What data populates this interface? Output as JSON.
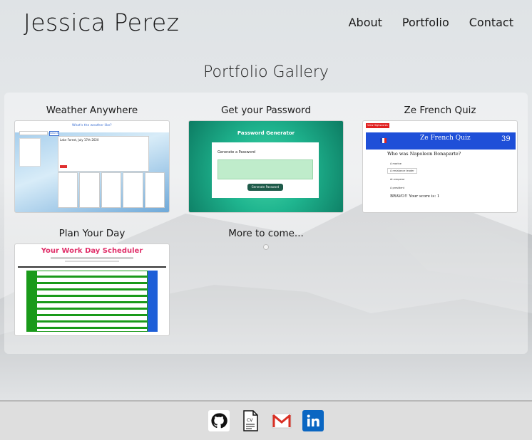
{
  "header": {
    "brand": "Jessica Perez",
    "nav": [
      "About",
      "Portfolio",
      "Contact"
    ]
  },
  "gallery": {
    "title": "Portfolio Gallery",
    "projects": [
      {
        "title": "Weather Anywhere",
        "screenshot": {
          "heading": "What's the weather like?",
          "search_button": "Search",
          "city_date": "Lake Forest, July 17th 2020"
        }
      },
      {
        "title": "Get your Password",
        "screenshot": {
          "heading": "Password Generator",
          "subheading": "Generate a Password",
          "button": "Generate Password"
        }
      },
      {
        "title": "Ze French Quiz",
        "screenshot": {
          "badge": "View Highscores",
          "banner": "Ze French Quiz",
          "timer": "39",
          "question": "Who was Napoleon Bonaparte?",
          "answers": [
            "A marine",
            "A resistance leader",
            "An emperor",
            "A president"
          ],
          "feedback": "BRAVO!! Your score is: 1"
        }
      },
      {
        "title": "Plan Your Day",
        "screenshot": {
          "heading": "Your Work Day Scheduler"
        }
      }
    ],
    "placeholder": "More to come..."
  },
  "footer": {
    "icons": [
      "github-icon",
      "cv-icon",
      "gmail-icon",
      "linkedin-icon"
    ]
  },
  "colors": {
    "linkedin": "#0a66c2",
    "gmail": "#d93025",
    "scheduler_green": "#1a9a1a",
    "password_teal": "#1fb58f",
    "quiz_blue": "#1e4fd8"
  }
}
